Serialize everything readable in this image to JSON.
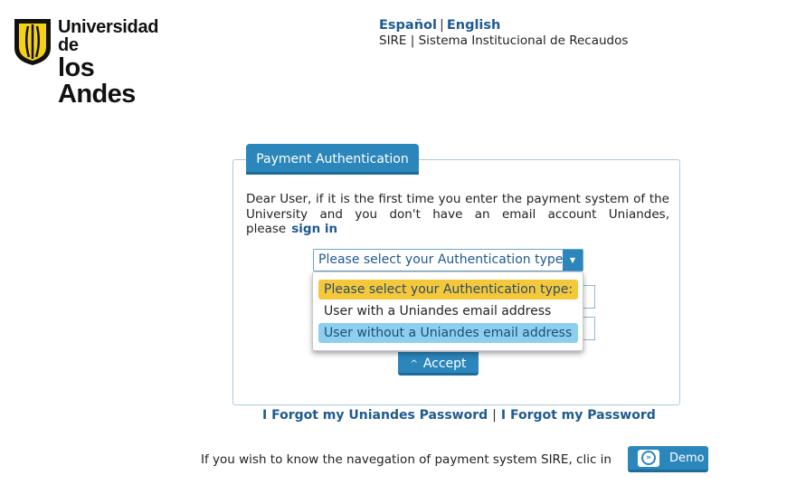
{
  "header": {
    "logo": {
      "line1": "Universidad de",
      "line2": "los Andes"
    },
    "lang_es": "Español",
    "lang_en": "English",
    "lang_sep": "|",
    "subtitle": "SIRE | Sistema Institucional de Recaudos"
  },
  "panel": {
    "title": "Payment Authentication",
    "text": "Dear User, if it is the first time you enter the payment system of the University and you don't have an email account Uniandes, please",
    "sign_in": "sign in",
    "select": {
      "selected": "Please select your Authentication type:",
      "options": [
        "Please select your Authentication type:",
        "User with a Uniandes email address",
        "User without a Uniandes email address"
      ]
    },
    "accept_label": "Accept"
  },
  "links": {
    "forgot_uniandes": "I Forgot my Uniandes Password",
    "sep": "|",
    "forgot_password": "I Forgot my Password"
  },
  "demo": {
    "text": "If you wish to know the navegation of payment system SIRE, clic in",
    "button_label": "Demo"
  },
  "colors": {
    "brand_blue": "#2b86bb",
    "link_blue": "#1e5a91",
    "highlight_yellow": "#f4c83a",
    "highlight_blue": "#8dcfef",
    "logo_yellow": "#f5d215"
  },
  "icons": {
    "select_arrow": "triangle-down-icon",
    "accept_caret": "chevron-up-icon",
    "demo": "double-chevron-right-icon"
  }
}
